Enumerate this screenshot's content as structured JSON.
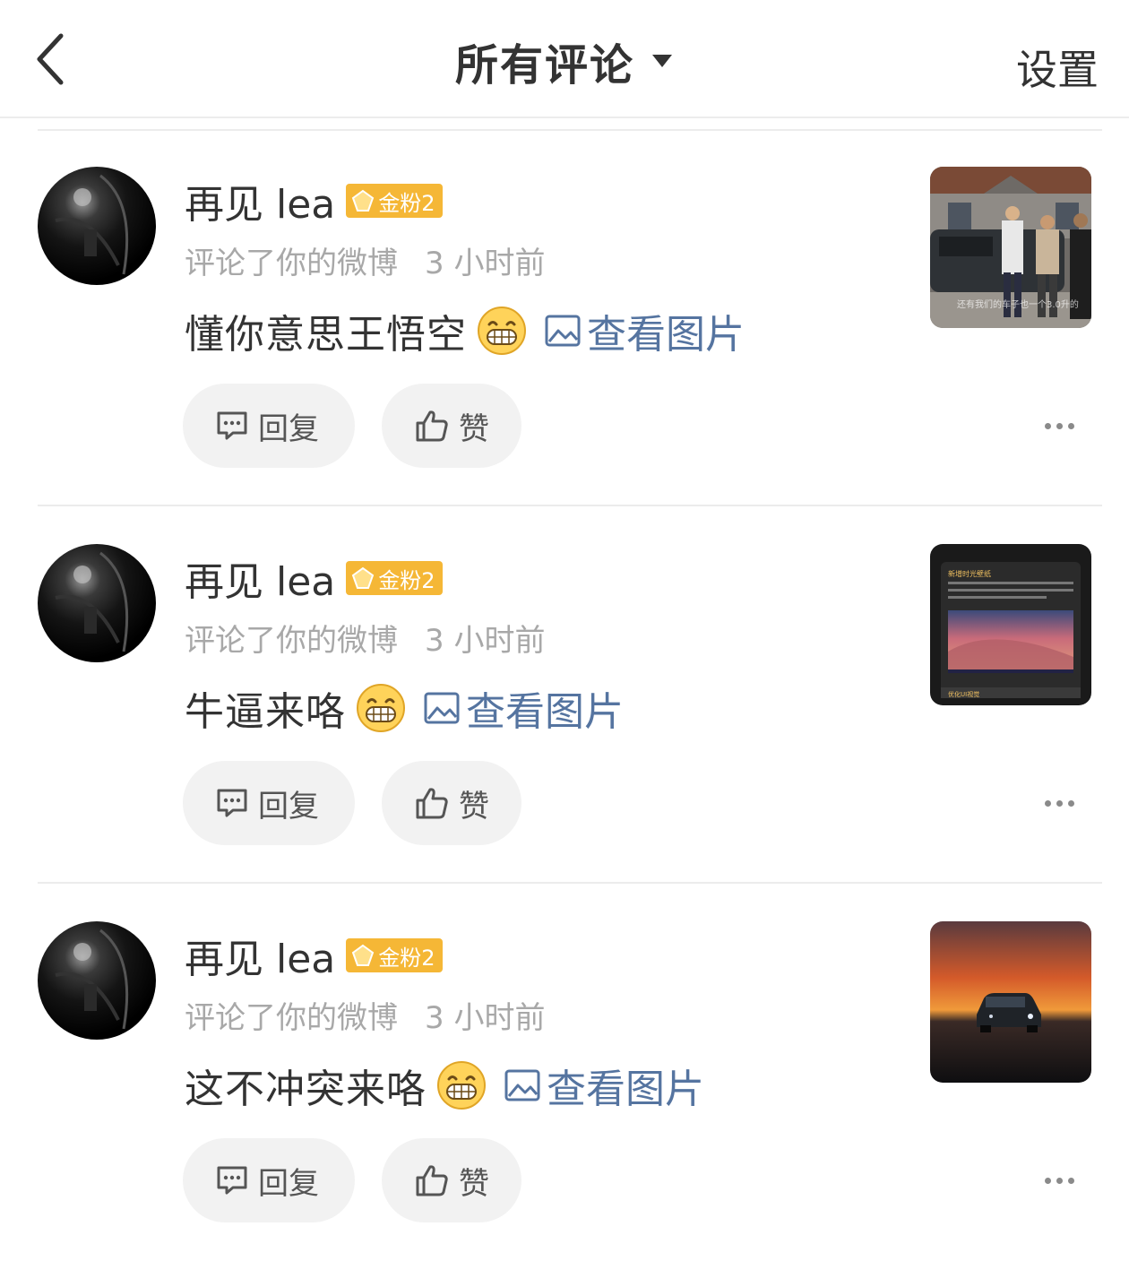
{
  "header": {
    "title": "所有评论",
    "settings_label": "设置"
  },
  "comments": [
    {
      "username": "再见 lea",
      "badge": "金粉2",
      "action": "评论了你的微博",
      "time": "3 小时前",
      "text": "懂你意思王悟空",
      "view_image_label": "查看图片",
      "reply_label": "回复",
      "like_label": "赞",
      "thumbnail_caption": "还有我们的车子也一个3.0升的"
    },
    {
      "username": "再见 lea",
      "badge": "金粉2",
      "action": "评论了你的微博",
      "time": "3 小时前",
      "text": "牛逼来咯",
      "view_image_label": "查看图片",
      "reply_label": "回复",
      "like_label": "赞",
      "thumbnail_heading": "新增时光壁纸",
      "thumbnail_footer": "优化UI视觉"
    },
    {
      "username": "再见 lea",
      "badge": "金粉2",
      "action": "评论了你的微博",
      "time": "3 小时前",
      "text": "这不冲突来咯",
      "view_image_label": "查看图片",
      "reply_label": "回复",
      "like_label": "赞"
    }
  ],
  "colors": {
    "link": "#5574a0",
    "badge": "#f5b736",
    "meta": "#a8a8a8",
    "pill_bg": "#f2f2f2"
  }
}
